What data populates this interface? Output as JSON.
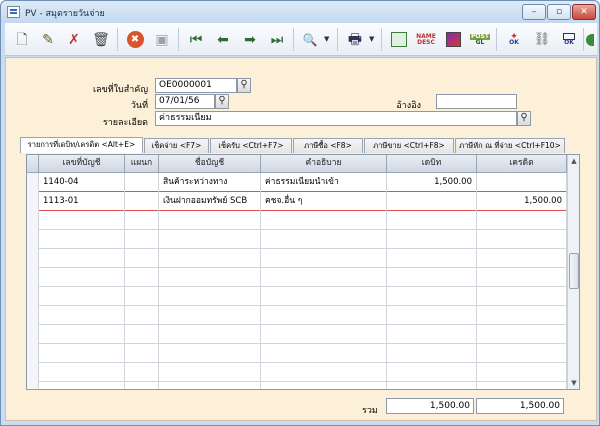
{
  "window": {
    "title": "PV - สมุดรายวันจ่าย",
    "controls": [
      "–",
      "▫",
      "✕"
    ]
  },
  "toolbar": {
    "items": [
      {
        "icon": "new-document-icon",
        "glyph": "🗋"
      },
      {
        "icon": "edit-document-icon",
        "glyph": "✎"
      },
      {
        "icon": "cancel-document-icon",
        "glyph": "✗"
      },
      {
        "icon": "delete-trash-icon",
        "glyph": "🗑"
      },
      {
        "icon": "stop-icon",
        "glyph": "✖"
      },
      {
        "icon": "save-disk-icon",
        "glyph": "▣"
      },
      {
        "icon": "first-record-icon",
        "glyph": "⏮"
      },
      {
        "icon": "previous-record-icon",
        "glyph": "⬅"
      },
      {
        "icon": "next-record-icon",
        "glyph": "➡"
      },
      {
        "icon": "last-record-icon",
        "glyph": "⏭"
      },
      {
        "icon": "find-icon",
        "glyph": "🔍"
      },
      {
        "icon": "print-icon",
        "glyph": "🖶"
      }
    ],
    "sort_name_desc": [
      "NAME",
      "DESC"
    ],
    "post_gl": [
      "POST",
      "GL"
    ],
    "ok_label": "OK"
  },
  "form": {
    "doc_no_label": "เลขที่ใบสำคัญ",
    "doc_no_value": "OE0000001",
    "date_label": "วันที่",
    "date_value": "07/01/56",
    "ref_label": "อ้างอิง",
    "ref_value": "",
    "detail_label": "รายละเอียด",
    "detail_value": "ค่าธรรมเนียม"
  },
  "tabs": [
    "รายการที่เดบิท/เครดิต <Alt+E>",
    "เช็คจ่าย <F7>",
    "เช็ครับ <Ctrl+F7>",
    "ภาษีซื้อ <F8>",
    "ภาษีขาย <Ctrl+F8>",
    "ภาษีหัก ณ ที่จ่าย <Ctrl+F10>"
  ],
  "grid": {
    "headers": [
      "เลขที่บัญชี",
      "แผนก",
      "ชื่อบัญชี",
      "คำอธิบาย",
      "เดบิท",
      "เครดิต"
    ],
    "rows": [
      {
        "account": "1140-04",
        "dept": "",
        "name": "สินค้าระหว่างทาง",
        "desc": "ค่าธรรมเนียมนำเข้า",
        "debit": "1,500.00",
        "credit": ""
      },
      {
        "account": "1113-01",
        "dept": "",
        "name": "เงินฝากออมทรัพย์ SCB",
        "desc": "คชจ.อื่น ๆ",
        "debit": "",
        "credit": "1,500.00"
      }
    ]
  },
  "totals": {
    "label": "รวม",
    "debit": "1,500.00",
    "credit": "1,500.00"
  }
}
